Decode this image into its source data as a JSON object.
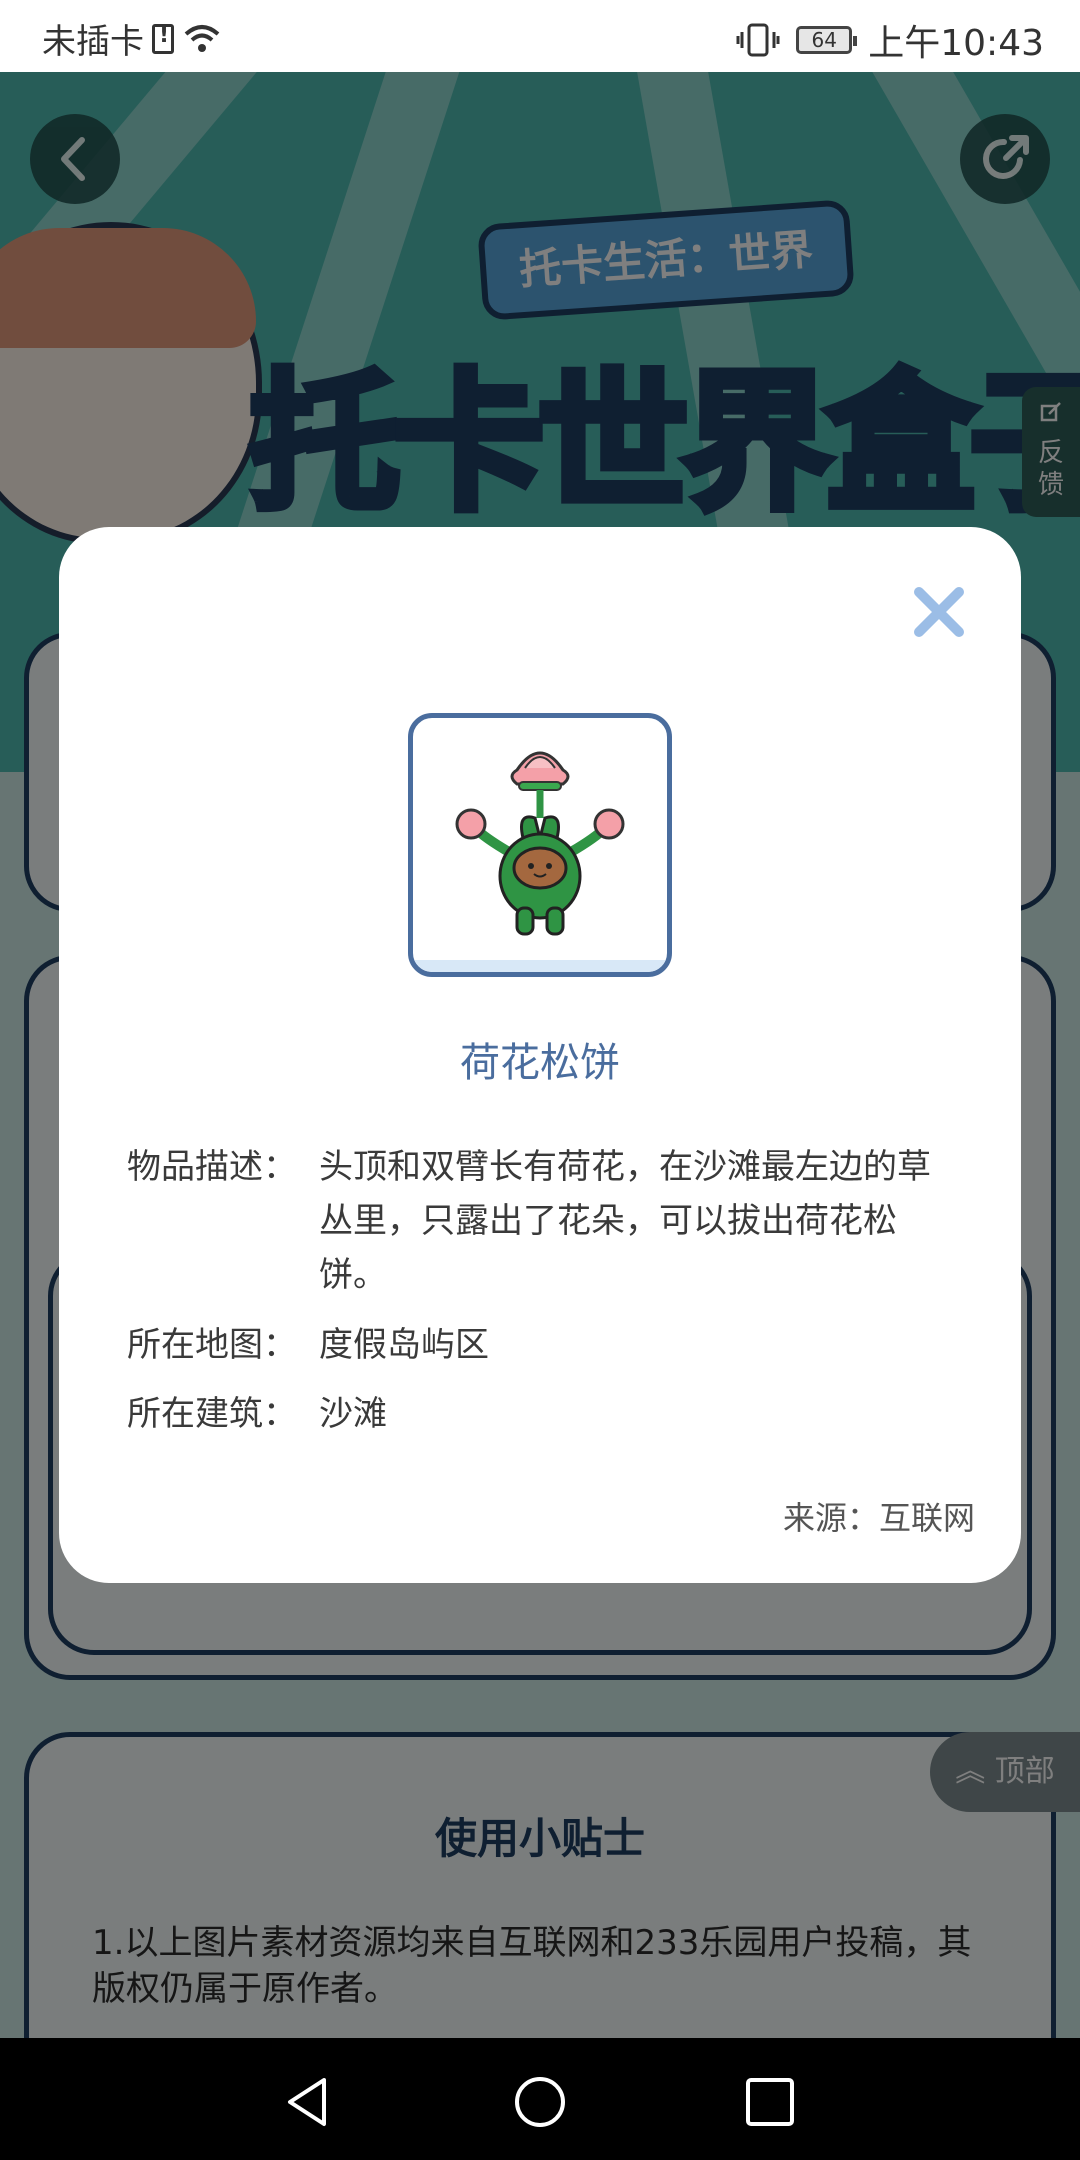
{
  "status_bar": {
    "carrier": "未插卡",
    "battery": "64",
    "time": "上午10:43"
  },
  "banner": {
    "bubble_text": "托卡生活：世界",
    "title_part1": "托卡世界",
    "title_part2": "盒子"
  },
  "feedback": "反馈",
  "tips": {
    "title": "使用小贴士",
    "text": "1.以上图片素材资源均来自互联网和233乐园用户投稿，其版权仍属于原作者。"
  },
  "to_top": "顶部",
  "modal": {
    "item_name": "荷花松饼",
    "rows": [
      {
        "label": "物品描述：",
        "value": "头顶和双臂长有荷花，在沙滩最左边的草丛里，只露出了花朵，可以拔出荷花松饼。"
      },
      {
        "label": "所在地图：",
        "value": "度假岛屿区"
      },
      {
        "label": "所在建筑：",
        "value": "沙滩"
      }
    ],
    "source": "来源：互联网"
  },
  "colors": {
    "accent": "#4a6d9e",
    "close": "#9bbde6",
    "banner": "#4fbab0"
  },
  "icons": {
    "back": "chevron-left-icon",
    "share": "share-icon",
    "close": "close-icon",
    "nav_back": "triangle-back-icon",
    "nav_home": "circle-home-icon",
    "nav_recent": "square-recent-icon"
  }
}
